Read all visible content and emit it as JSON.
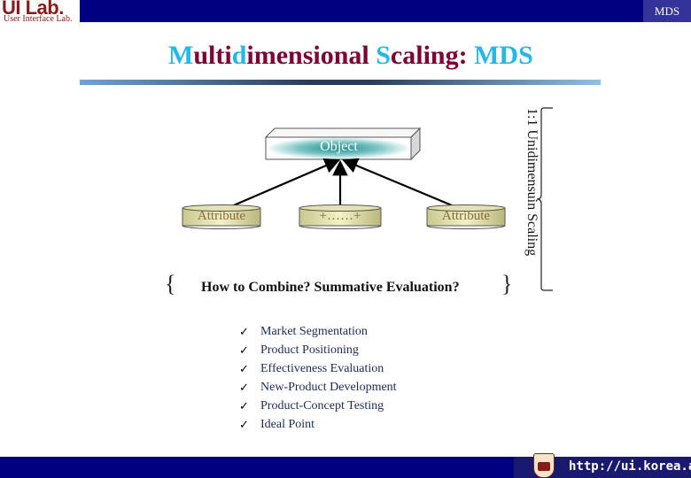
{
  "header": {
    "logo_main": "UI Lab.",
    "logo_sub": "User Interface Lab.",
    "section_tag": "MDS"
  },
  "title": {
    "parts": [
      {
        "text": "M",
        "highlight": true
      },
      {
        "text": "ulti",
        "highlight": false
      },
      {
        "text": "d",
        "highlight": true
      },
      {
        "text": "imensional ",
        "highlight": false
      },
      {
        "text": "S",
        "highlight": true
      },
      {
        "text": "caling: ",
        "highlight": false
      },
      {
        "text": "MDS",
        "highlight": true
      }
    ],
    "colors": {
      "main": "#800033",
      "highlight": "#22b8e8"
    }
  },
  "diagram": {
    "object_label": "Object",
    "attributes": [
      {
        "label": "Attribute"
      },
      {
        "label": "+……+"
      },
      {
        "label": "Attribute"
      }
    ],
    "vertical_label": "1:1 Unidimensuin Scaling",
    "question": "How to Combine? Summative Evaluation?"
  },
  "applications": {
    "check_icon": "✓",
    "items": [
      "Market Segmentation",
      "Product Positioning",
      "Effectiveness Evaluation",
      "New-Product Development",
      "Product-Concept Testing",
      "Ideal Point"
    ]
  },
  "footer": {
    "url": "http://ui.korea.ac.kr"
  },
  "colors": {
    "navy": "#000080",
    "tag_bg": "#333399"
  }
}
